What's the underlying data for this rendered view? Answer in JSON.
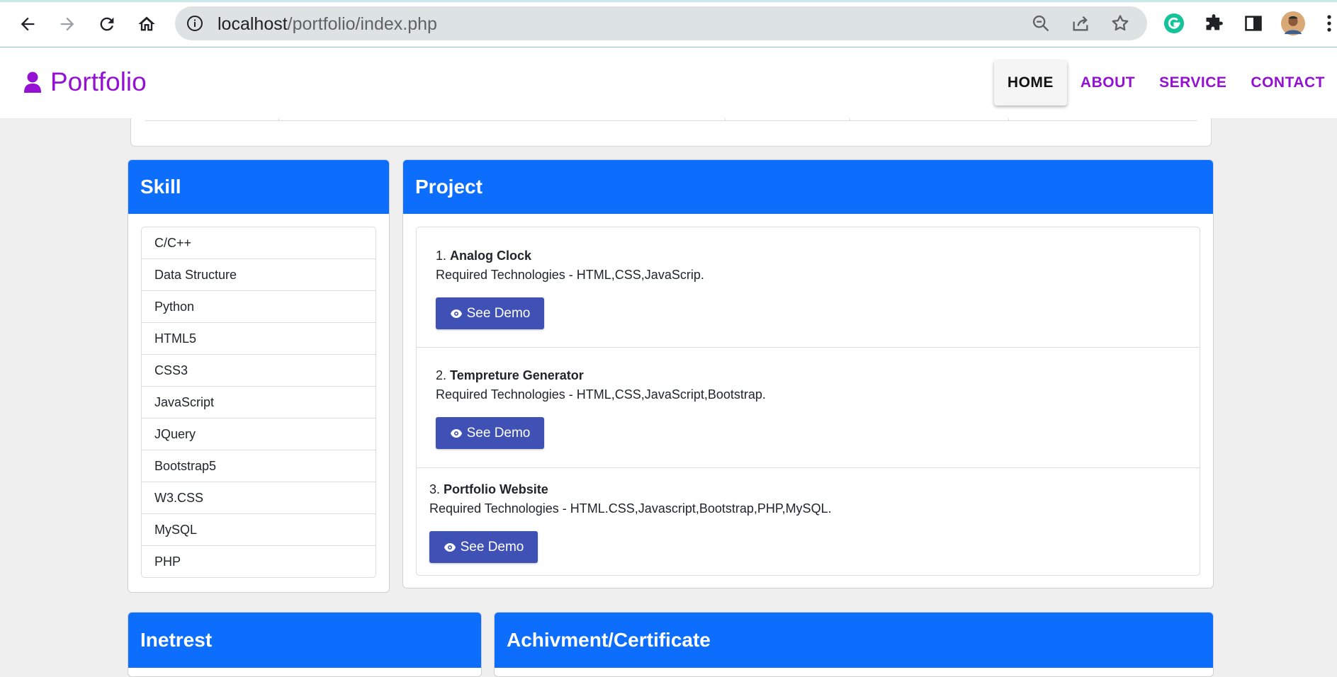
{
  "browser": {
    "url_host": "localhost",
    "url_path": "/portfolio/index.php"
  },
  "navbar": {
    "brand": "Portfolio",
    "links": [
      "HOME",
      "ABOUT",
      "SERVICE",
      "CONTACT"
    ],
    "active": "HOME"
  },
  "skill": {
    "title": "Skill",
    "items": [
      "C/C++",
      "Data Structure",
      "Python",
      "HTML5",
      "CSS3",
      "JavaScript",
      "JQuery",
      "Bootstrap5",
      "W3.CSS",
      "MySQL",
      "PHP"
    ]
  },
  "project": {
    "title": "Project",
    "items": [
      {
        "num": "1.",
        "name": "Analog Clock",
        "tech": "Required Technologies - HTML,CSS,JavaScrip.",
        "button": "See Demo"
      },
      {
        "num": "2.",
        "name": "Tempreture Generator",
        "tech": "Required Technologies - HTML,CSS,JavaScript,Bootstrap.",
        "button": "See Demo"
      },
      {
        "num": "3.",
        "name": "Portfolio Website",
        "tech": "Required Technologies - HTML.CSS,Javascript,Bootstrap,PHP,MySQL.",
        "button": "See Demo"
      }
    ]
  },
  "interest": {
    "title": "Inetrest"
  },
  "achievement": {
    "title": "Achivment/Certificate"
  },
  "colors": {
    "primary": "#0d6efd",
    "brand": "#9410d2",
    "demo_button": "#3f51b5",
    "page_bg": "#efefef"
  }
}
